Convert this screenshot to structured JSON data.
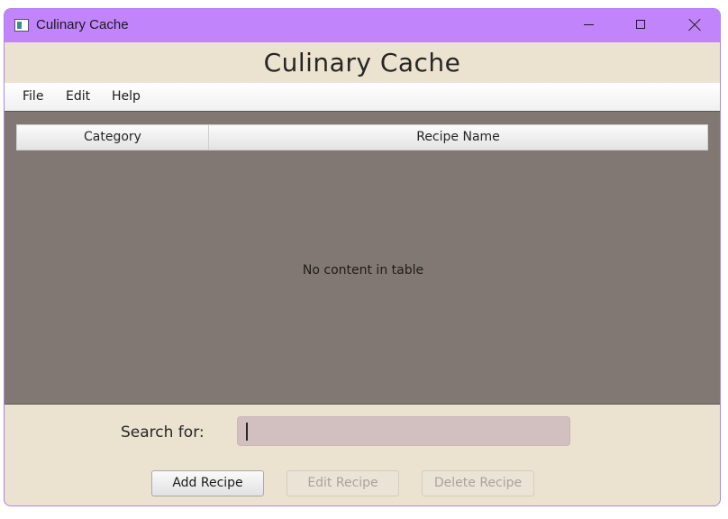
{
  "window": {
    "title": "Culinary Cache"
  },
  "app": {
    "heading": "Culinary Cache"
  },
  "menu": {
    "items": [
      {
        "label": "File"
      },
      {
        "label": "Edit"
      },
      {
        "label": "Help"
      }
    ]
  },
  "table": {
    "columns": [
      "Category",
      "Recipe Name"
    ],
    "rows": [],
    "empty_message": "No content in table"
  },
  "search": {
    "label": "Search for:",
    "value": ""
  },
  "buttons": {
    "add": "Add Recipe",
    "edit": "Edit Recipe",
    "delete": "Delete Recipe"
  },
  "icons": {
    "app": "app-window-icon",
    "minimize": "minimize-icon",
    "maximize": "maximize-icon",
    "close": "close-icon"
  },
  "colors": {
    "titlebar": "#c184fb",
    "background": "#ece2d0",
    "table_background": "#817873",
    "search_field": "#d1c0bf"
  }
}
